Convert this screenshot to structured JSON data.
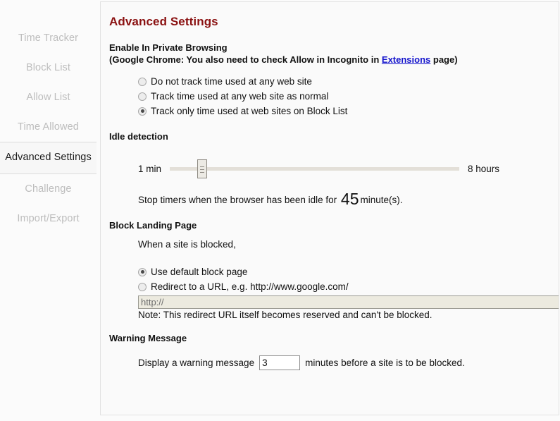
{
  "sidebar": {
    "items": [
      {
        "label": "Time Tracker",
        "active": false
      },
      {
        "label": "Block List",
        "active": false
      },
      {
        "label": "Allow List",
        "active": false
      },
      {
        "label": "Time Allowed",
        "active": false
      },
      {
        "label": "Advanced Settings",
        "active": true
      },
      {
        "label": "Challenge",
        "active": false
      },
      {
        "label": "Import/Export",
        "active": false
      }
    ]
  },
  "page": {
    "title": "Advanced Settings",
    "title_color": "#8a1111"
  },
  "private_browsing": {
    "heading": "Enable In Private Browsing",
    "subheading_before_link": "(Google Chrome: You also need to check Allow in Incognito in ",
    "link_label": "Extensions",
    "subheading_after_link": " page)",
    "link_color": "#1414cc",
    "options": [
      {
        "label": "Do not track time used at any web site",
        "selected": false
      },
      {
        "label": "Track time used at any web site as normal",
        "selected": false
      },
      {
        "label": "Track only time used at web sites on Block List",
        "selected": true
      }
    ]
  },
  "idle_detection": {
    "heading": "Idle detection",
    "slider_min_label": "1 min",
    "slider_max_label": "8 hours",
    "slider_value_percent": 10,
    "summary_prefix": "Stop timers when the browser has been idle for",
    "summary_value": "45",
    "summary_suffix": "minute(s)."
  },
  "block_landing_page": {
    "heading": "Block Landing Page",
    "intro": "When a site is blocked,",
    "options": [
      {
        "label": "Use default block page",
        "selected": true
      },
      {
        "label": "Redirect to a URL, e.g. http://www.google.com/",
        "selected": false
      }
    ],
    "url_value": "http://",
    "note": "Note: This redirect URL itself becomes reserved and can't be blocked."
  },
  "warning_message": {
    "heading": "Warning Message",
    "prefix": "Display a warning message",
    "value": "3",
    "suffix": "minutes before a site is to be blocked."
  }
}
